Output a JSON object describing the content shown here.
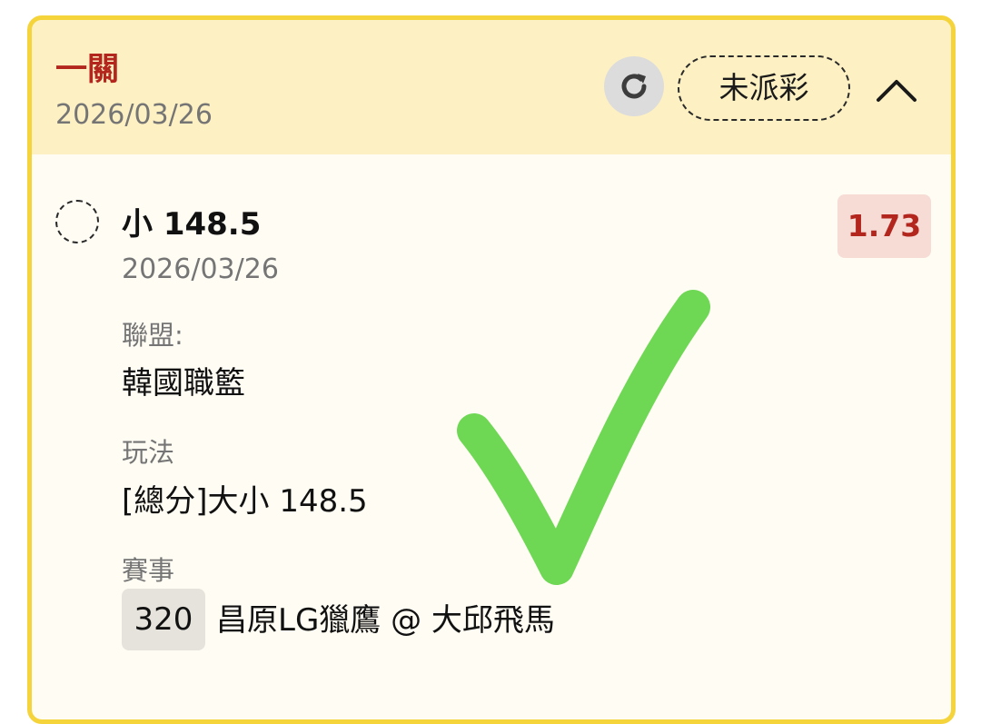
{
  "header": {
    "bet_type": "一關",
    "date": "2026/03/26",
    "status": "未派彩"
  },
  "icons": {
    "refresh": "refresh-icon",
    "collapse": "chevron-up-icon",
    "selection": "dashed-radio-icon",
    "result": "check-mark"
  },
  "selection": {
    "name": "小 148.5",
    "date": "2026/03/26",
    "odds": "1.73"
  },
  "details": {
    "league_label": "聯盟:",
    "league_value": "韓國職籃",
    "market_label": "玩法",
    "market_value": "[總分]大小 148.5",
    "event_label": "賽事",
    "event_number": "320",
    "event_name": "昌原LG獵鷹 @ 大邱飛馬"
  },
  "colors": {
    "accent_red": "#b3261e",
    "card_border": "#f5d33a",
    "header_bg": "#fdf0c2",
    "checkmark_green": "#6ed855"
  }
}
